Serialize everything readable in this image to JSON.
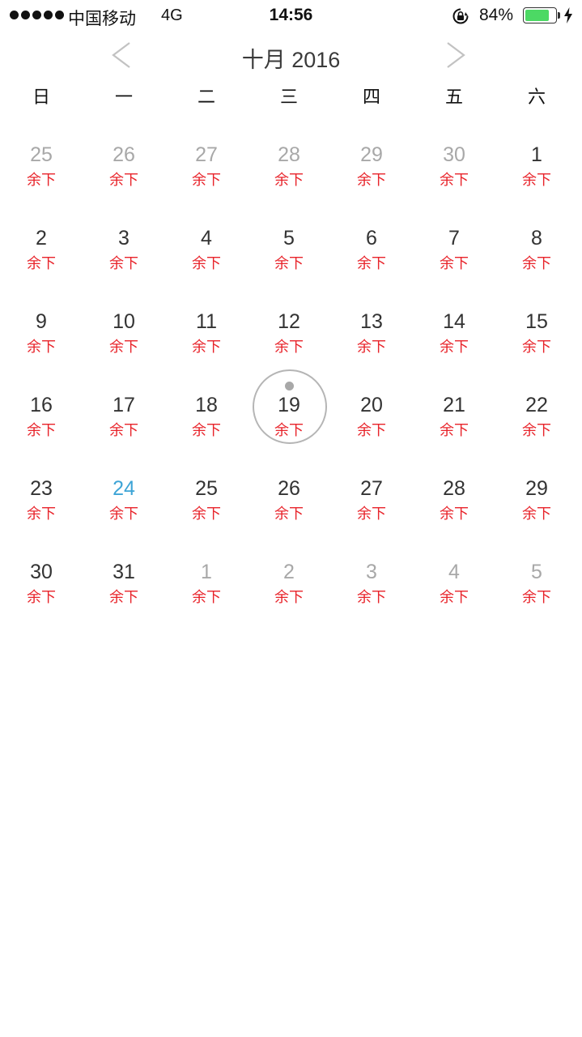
{
  "status_bar": {
    "carrier": "中国移动",
    "network": "4G",
    "time": "14:56",
    "battery_percent_text": "84%",
    "battery_level": 0.84,
    "battery_color": "#4cd964"
  },
  "calendar": {
    "month_title": "十月 2016",
    "prev_icon": "chevron-left-icon",
    "next_icon": "chevron-right-icon",
    "weekdays": [
      "日",
      "一",
      "二",
      "三",
      "四",
      "五",
      "六"
    ],
    "note_label": "余下",
    "today_color": "#3da4d6",
    "note_color": "#e8232a",
    "days": [
      {
        "n": "25",
        "state": "other"
      },
      {
        "n": "26",
        "state": "other"
      },
      {
        "n": "27",
        "state": "other"
      },
      {
        "n": "28",
        "state": "other"
      },
      {
        "n": "29",
        "state": "other"
      },
      {
        "n": "30",
        "state": "other"
      },
      {
        "n": "1",
        "state": "current"
      },
      {
        "n": "2",
        "state": "current"
      },
      {
        "n": "3",
        "state": "current"
      },
      {
        "n": "4",
        "state": "current"
      },
      {
        "n": "5",
        "state": "current"
      },
      {
        "n": "6",
        "state": "current"
      },
      {
        "n": "7",
        "state": "current"
      },
      {
        "n": "8",
        "state": "current"
      },
      {
        "n": "9",
        "state": "current"
      },
      {
        "n": "10",
        "state": "current"
      },
      {
        "n": "11",
        "state": "current"
      },
      {
        "n": "12",
        "state": "current"
      },
      {
        "n": "13",
        "state": "current"
      },
      {
        "n": "14",
        "state": "current"
      },
      {
        "n": "15",
        "state": "current"
      },
      {
        "n": "16",
        "state": "current"
      },
      {
        "n": "17",
        "state": "current"
      },
      {
        "n": "18",
        "state": "current"
      },
      {
        "n": "19",
        "state": "selected",
        "has_event": true
      },
      {
        "n": "20",
        "state": "current"
      },
      {
        "n": "21",
        "state": "current"
      },
      {
        "n": "22",
        "state": "current"
      },
      {
        "n": "23",
        "state": "current"
      },
      {
        "n": "24",
        "state": "today"
      },
      {
        "n": "25",
        "state": "current"
      },
      {
        "n": "26",
        "state": "current"
      },
      {
        "n": "27",
        "state": "current"
      },
      {
        "n": "28",
        "state": "current"
      },
      {
        "n": "29",
        "state": "current"
      },
      {
        "n": "30",
        "state": "current"
      },
      {
        "n": "31",
        "state": "current"
      },
      {
        "n": "1",
        "state": "other"
      },
      {
        "n": "2",
        "state": "other"
      },
      {
        "n": "3",
        "state": "other"
      },
      {
        "n": "4",
        "state": "other"
      },
      {
        "n": "5",
        "state": "other"
      }
    ]
  }
}
